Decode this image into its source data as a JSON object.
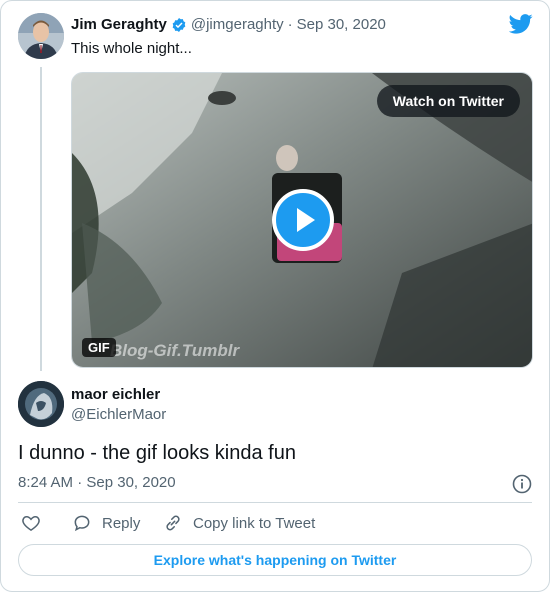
{
  "quoted_tweet": {
    "author_name": "Jim Geraghty",
    "author_handle": "@jimgeraghty",
    "separator": "·",
    "date": "Sep 30, 2020",
    "text": "This whole night...",
    "media": {
      "watch_label": "Watch on Twitter",
      "gif_badge": "GIF",
      "watermark": "Blog-Gif.Tumblr"
    }
  },
  "reply_tweet": {
    "author_name": "maor eichler",
    "author_handle": "@EichlerMaor",
    "text": "I dunno - the gif looks kinda fun",
    "timestamp": "8:24 AM · Sep 30, 2020"
  },
  "actions": {
    "reply_label": "Reply",
    "copy_link_label": "Copy link to Tweet"
  },
  "explore_label": "Explore what's happening on Twitter",
  "colors": {
    "twitter_blue": "#1d9bf0",
    "text_primary": "#0f1419",
    "text_secondary": "#536471",
    "border": "#cfd9de"
  },
  "icons": [
    "twitter-bird-icon",
    "verified-badge-icon",
    "play-icon",
    "info-icon",
    "heart-icon",
    "reply-icon",
    "link-icon"
  ]
}
